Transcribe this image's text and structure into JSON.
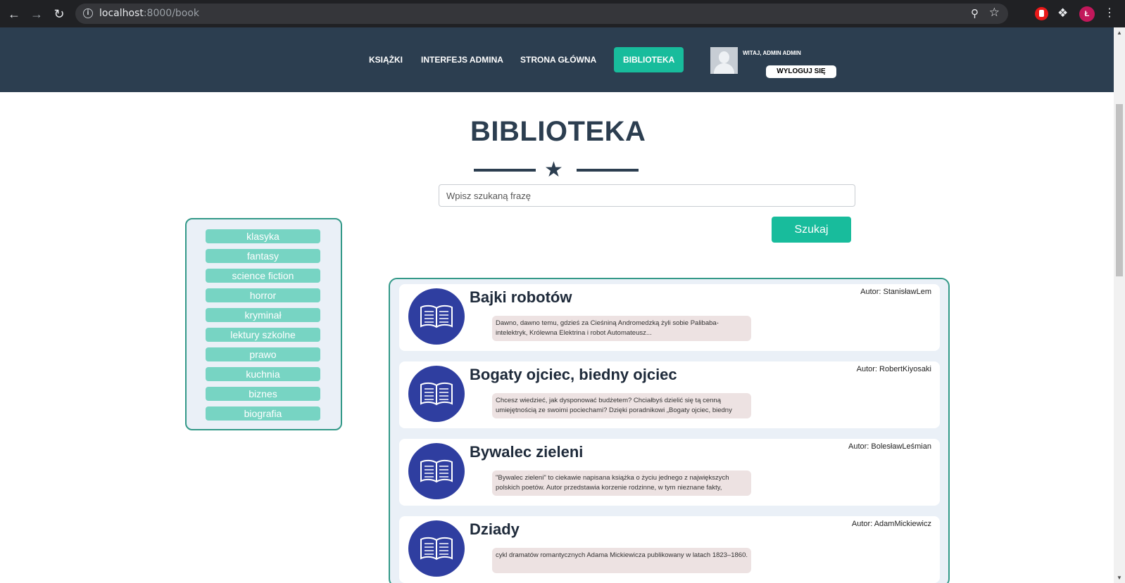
{
  "browser": {
    "url_host": "localhost",
    "url_rest": ":8000/book",
    "profile_initial": "Ł"
  },
  "nav": {
    "items": [
      "KSIĄŻKI",
      "INTERFEJS ADMINA",
      "STRONA GŁÓWNA",
      "BIBLIOTEKA"
    ],
    "active_index": 3,
    "greeting": "WITAJ, ADMIN ADMIN",
    "logout_label": "WYLOGUJ SIĘ"
  },
  "page": {
    "title": "BIBLIOTEKA",
    "search_placeholder": "Wpisz szukaną frazę",
    "search_button": "Szukaj"
  },
  "categories": [
    "klasyka",
    "fantasy",
    "science fiction",
    "horror",
    "kryminał",
    "lektury szkolne",
    "prawo",
    "kuchnia",
    "biznes",
    "biografia"
  ],
  "books": [
    {
      "title": "Bajki robotów",
      "author": "Autor: StanisławLem",
      "description": "Dawno, dawno temu, gdzieś za Cieśniną Andromedzką żyli sobie Palibaba-intelektryk, Królewna Elektrina i robot Automateusz..."
    },
    {
      "title": "Bogaty ojciec, biedny ojciec",
      "author": "Autor: RobertKiyosaki",
      "description": "Chcesz wiedzieć, jak dysponować budżetem? Chciałbyś dzielić się tą cenną umiejętnością ze swoimi pociechami? Dzięki poradnikowi „Bogaty ojciec, biedny"
    },
    {
      "title": "Bywalec zieleni",
      "author": "Autor: BolesławLeśmian",
      "description": "\"Bywalec zieleni\" to ciekawie napisana książka o życiu jednego z największych polskich poetów. Autor przedstawia korzenie rodzinne, w tym nieznane fakty,"
    },
    {
      "title": "Dziady",
      "author": "Autor: AdamMickiewicz",
      "description": "cykl dramatów romantycznych Adama Mickiewicza publikowany w latach 1823–1860."
    }
  ],
  "colors": {
    "header_bg": "#2c3e50",
    "accent": "#18bc9c",
    "category_bg": "#77d4c3",
    "book_icon_bg": "#2f3ea0",
    "panel_border": "#339988"
  }
}
